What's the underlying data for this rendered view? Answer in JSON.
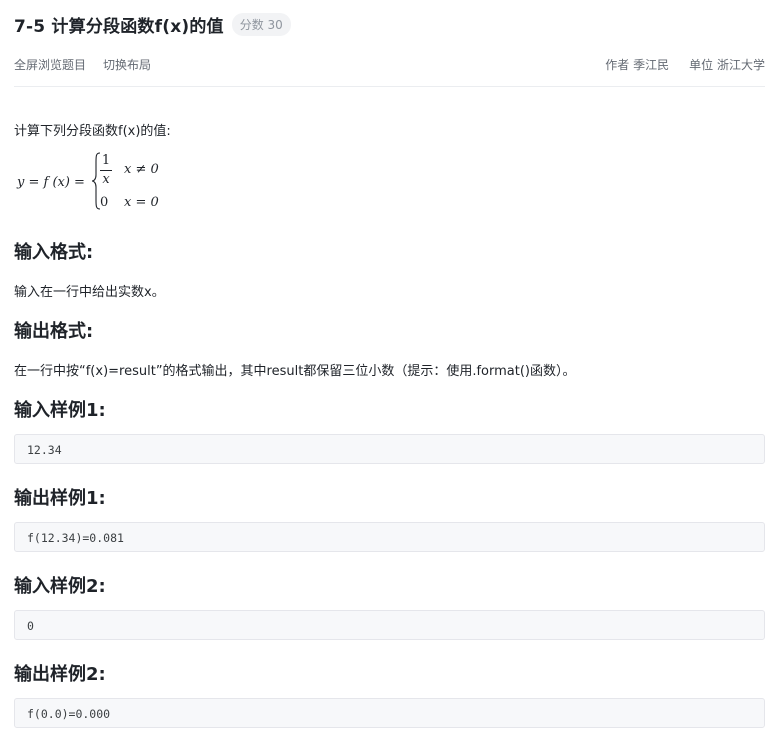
{
  "header": {
    "title": "7-5 计算分段函数f(x)的值",
    "score": "分数 30"
  },
  "toolbar": {
    "fullscreen_label": "全屏浏览题目",
    "switch_layout_label": "切换布局",
    "author_label": "作者",
    "author": "季江民",
    "unit_label": "单位",
    "unit": "浙江大学"
  },
  "problem": {
    "intro": "计算下列分段函数f(x)的值:",
    "formula": {
      "lhs": "y = f (x) =",
      "case1_numerator": "1",
      "case1_denominator": "x",
      "case1_condition": "x ≠ 0",
      "case2_value": "0",
      "case2_condition": "x = 0"
    },
    "input_format_title": "输入格式:",
    "input_format_text": "输入在一行中给出实数x。",
    "output_format_title": "输出格式:",
    "output_format_text": "在一行中按“f(x)=result”的格式输出，其中result都保留三位小数（提示：使用.format()函数）。",
    "samples": [
      {
        "title": "输入样例1:",
        "content": "12.34"
      },
      {
        "title": "输出样例1:",
        "content": "f(12.34)=0.081"
      },
      {
        "title": "输入样例2:",
        "content": "0"
      },
      {
        "title": "输出样例2:",
        "content": "f(0.0)=0.000"
      }
    ]
  },
  "colors": {
    "text": "#1f2329",
    "muted": "#646a73",
    "badge_bg": "#f2f3f5",
    "code_bg": "#f7f8fa",
    "code_border": "#e5e6eb"
  }
}
